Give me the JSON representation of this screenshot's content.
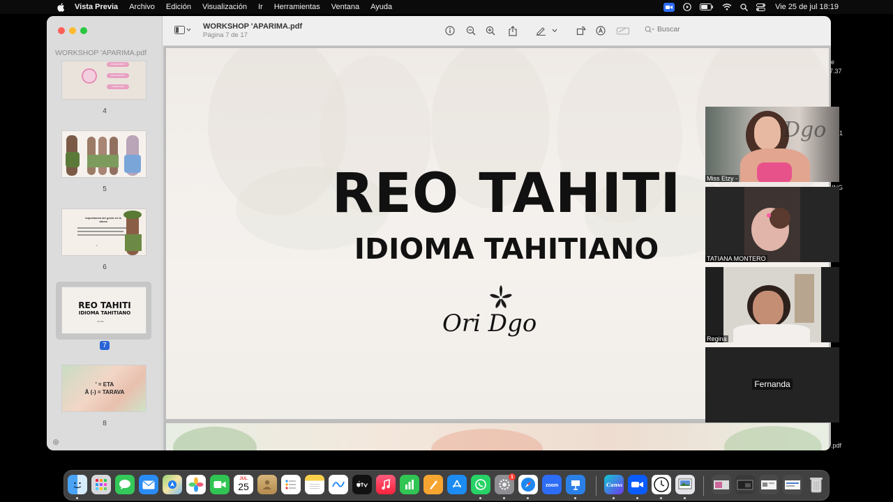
{
  "menubar": {
    "app_name": "Vista Previa",
    "menus": [
      "Archivo",
      "Edición",
      "Visualización",
      "Ir",
      "Herramientas",
      "Ventana",
      "Ayuda"
    ],
    "clock": "Vie 25 de jul  18:19",
    "status_icons": [
      "zoom-icon",
      "play-icon",
      "battery-icon",
      "wifi-icon",
      "search-icon",
      "control-center-icon"
    ]
  },
  "window": {
    "sidebar_title": "WORKSHOP 'APARIMA.pdf",
    "doc_title": "WORKSHOP 'APARIMA.pdf",
    "page_info": "Página 7 de 17",
    "search_placeholder": "Buscar",
    "thumbnails": [
      {
        "page": "4",
        "texts": [
          "FORMA LENTA",
          "BAILE LENTO",
          "CALMA AQUÍ"
        ]
      },
      {
        "page": "5"
      },
      {
        "page": "6",
        "texts": [
          "Importancia del gesto en la danza"
        ]
      },
      {
        "page": "7",
        "texts": [
          "REO TAHITI",
          "IDIOMA TAHITIANO"
        ],
        "selected": true
      },
      {
        "page": "8",
        "texts": [
          "' = ETA",
          "Ā (-) = TARAVA"
        ]
      }
    ]
  },
  "slide": {
    "title": "REO TAHITI",
    "subtitle": "IDIOMA TAHITIANO",
    "logo": "Ori Dgo"
  },
  "zoom": {
    "participants": [
      {
        "name": "Miss Etzy -"
      },
      {
        "name": "TATIANA MONTERO"
      },
      {
        "name": "Regina"
      },
      {
        "name": "Fernanda",
        "video": false
      }
    ],
    "edge_texts": [
      "e",
      "7.37",
      "1",
      "ING",
      ".pdf"
    ]
  },
  "dock": {
    "calendar_day": "25",
    "calendar_month": "JUL",
    "settings_badge": "1",
    "apps": [
      "Finder",
      "Launchpad",
      "Messages",
      "Mail",
      "Maps",
      "Photos",
      "FaceTime",
      "Calendar",
      "Notes",
      "Reminders",
      "Notes",
      "Freeform",
      "TV",
      "Music",
      "Numbers",
      "Pages",
      "App Store",
      "WhatsApp",
      "System Settings",
      "Safari",
      "Zoom",
      "Keynote",
      "Canva",
      "Zoom Workplace",
      "Clock",
      "Preview",
      "Trash"
    ]
  }
}
